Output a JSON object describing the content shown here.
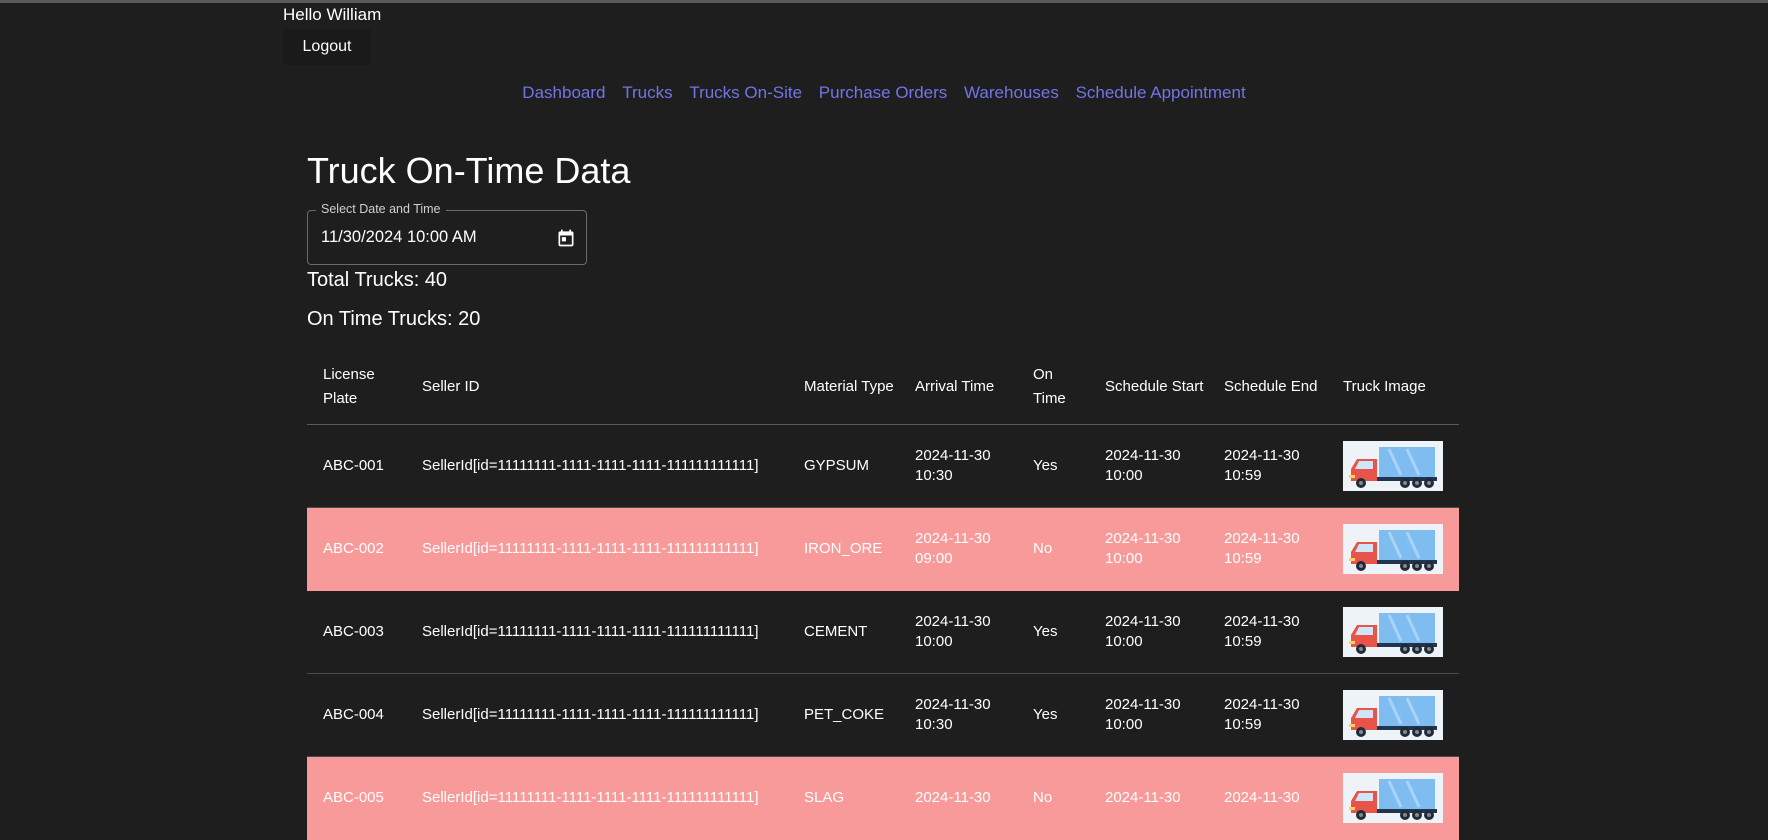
{
  "header": {
    "greeting": "Hello William",
    "logout_label": "Logout"
  },
  "nav": {
    "items": [
      "Dashboard",
      "Trucks",
      "Trucks On-Site",
      "Purchase Orders",
      "Warehouses",
      "Schedule Appointment"
    ]
  },
  "main": {
    "title": "Truck On-Time Data",
    "date_label": "Select Date and Time",
    "date_value": "11/30/2024 10:00 AM",
    "total_trucks": "Total Trucks: 40",
    "on_time_trucks": "On Time Trucks: 20"
  },
  "table": {
    "headers": {
      "license_plate": "License Plate",
      "seller_id": "Seller ID",
      "material_type": "Material Type",
      "arrival_time": "Arrival Time",
      "on_time": "On Time",
      "schedule_start": "Schedule Start",
      "schedule_end": "Schedule End",
      "truck_image": "Truck Image"
    },
    "rows": [
      {
        "plate": "ABC-001",
        "seller": "SellerId[id=11111111-1111-1111-1111-111111111111]",
        "material": "GYPSUM",
        "arrival": "2024-11-30 10:30",
        "on_time": "Yes",
        "start": "2024-11-30 10:00",
        "end": "2024-11-30 10:59"
      },
      {
        "plate": "ABC-002",
        "seller": "SellerId[id=11111111-1111-1111-1111-111111111111]",
        "material": "IRON_ORE",
        "arrival": "2024-11-30 09:00",
        "on_time": "No",
        "start": "2024-11-30 10:00",
        "end": "2024-11-30 10:59"
      },
      {
        "plate": "ABC-003",
        "seller": "SellerId[id=11111111-1111-1111-1111-111111111111]",
        "material": "CEMENT",
        "arrival": "2024-11-30 10:00",
        "on_time": "Yes",
        "start": "2024-11-30 10:00",
        "end": "2024-11-30 10:59"
      },
      {
        "plate": "ABC-004",
        "seller": "SellerId[id=11111111-1111-1111-1111-111111111111]",
        "material": "PET_COKE",
        "arrival": "2024-11-30 10:30",
        "on_time": "Yes",
        "start": "2024-11-30 10:00",
        "end": "2024-11-30 10:59"
      },
      {
        "plate": "ABC-005",
        "seller": "SellerId[id=11111111-1111-1111-1111-111111111111]",
        "material": "SLAG",
        "arrival": "2024-11-30",
        "on_time": "No",
        "start": "2024-11-30",
        "end": "2024-11-30"
      }
    ]
  },
  "colors": {
    "background": "#1e1e1e",
    "link": "#7175e6",
    "late_row": "#f99a9a"
  }
}
